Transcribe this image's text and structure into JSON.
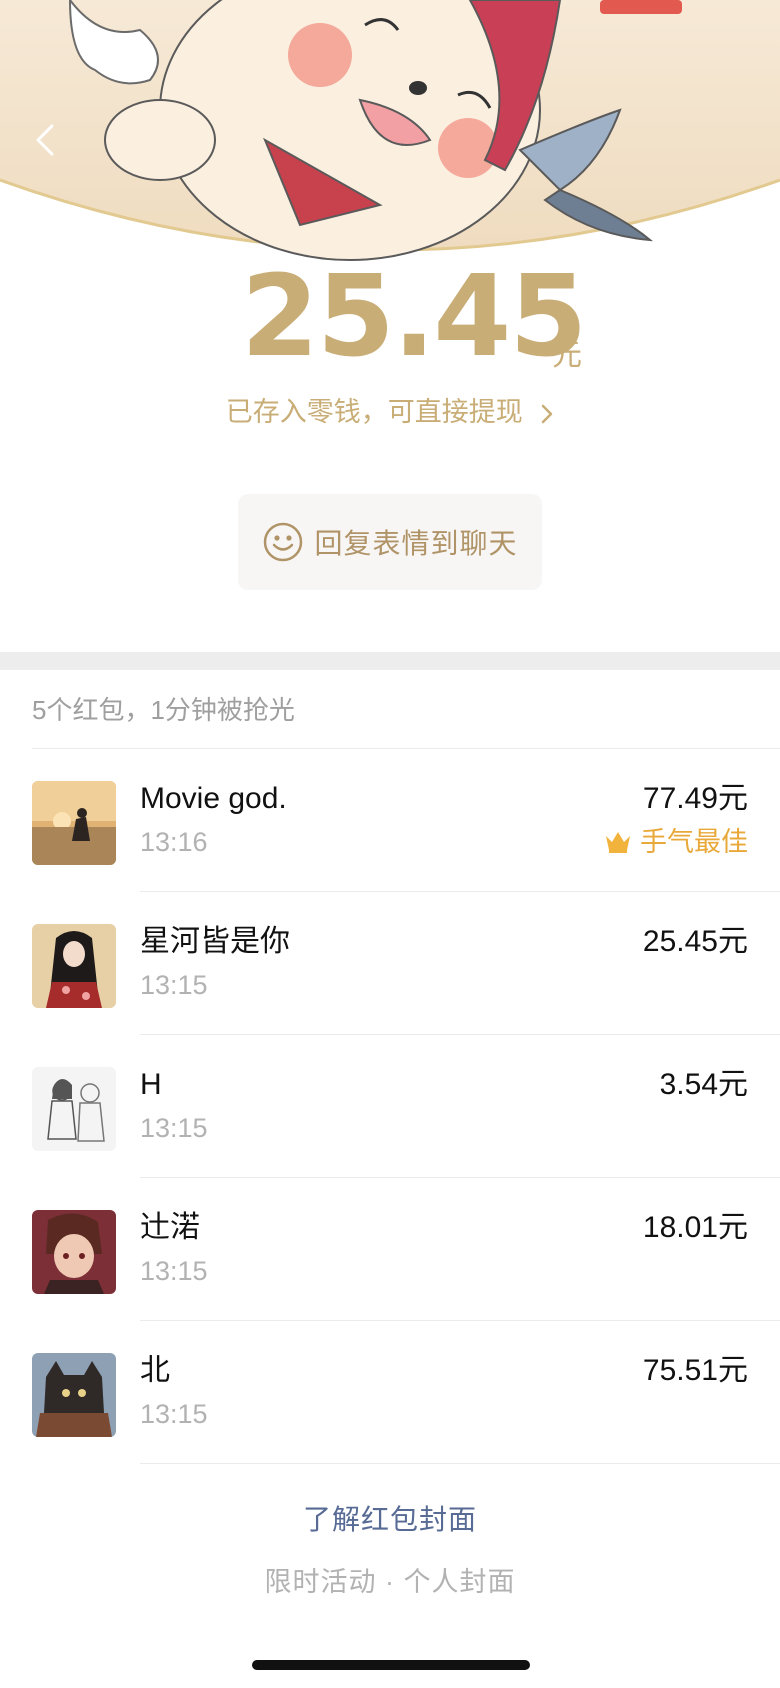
{
  "header": {
    "illustration": "cartoon-seal-red-packet-cover",
    "back_icon": "chevron-left-icon"
  },
  "amount": {
    "value": "25.45",
    "unit": "元",
    "saved_note": "已存入零钱，可直接提现"
  },
  "reply_button": {
    "icon": "smiley-icon",
    "label": "回复表情到聊天"
  },
  "summary": "5个红包，1分钟被抢光",
  "records": [
    {
      "name": "Movie god.",
      "time": "13:16",
      "amount": "77.49元",
      "badge": "手气最佳",
      "avatar": "sunset-couple-avatar"
    },
    {
      "name": "星河皆是你",
      "time": "13:15",
      "amount": "25.45元",
      "avatar": "anime-girl-kimono-avatar"
    },
    {
      "name": "H",
      "time": "13:15",
      "amount": "3.54元",
      "avatar": "sketch-figures-avatar"
    },
    {
      "name": "辻渃",
      "time": "13:15",
      "amount": "18.01元",
      "avatar": "anime-boy-avatar"
    },
    {
      "name": "北",
      "time": "13:15",
      "amount": "75.51元",
      "avatar": "black-cat-avatar"
    }
  ],
  "footer": {
    "cover_link": "了解红包封面",
    "cover_sub": "限时活动 · 个人封面"
  },
  "colors": {
    "gold": "#c9ad77",
    "best_badge": "#e9a93a",
    "link": "#576b95",
    "muted": "#b2b2b2"
  }
}
